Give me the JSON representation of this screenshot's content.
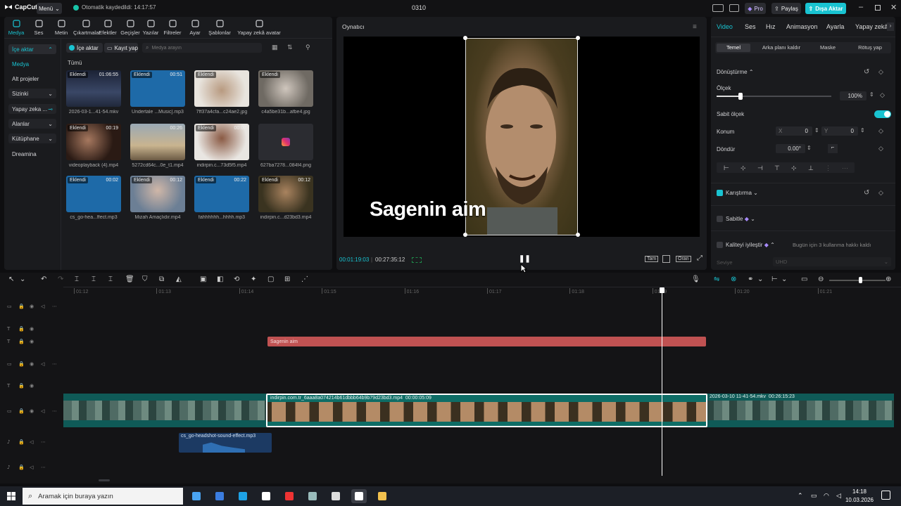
{
  "topbar": {
    "logo": "CapCut",
    "menu": "Menü",
    "autosave": "Otomatik kaydedildi: 14:17:57",
    "project_title": "0310",
    "pro": "Pro",
    "share": "Paylaş",
    "export": "Dışa Aktar",
    "accent": "#19c3d1"
  },
  "toolbar": [
    {
      "label": "Medya",
      "icon": "media-icon"
    },
    {
      "label": "Ses",
      "icon": "audio-icon"
    },
    {
      "label": "Metin",
      "icon": "text-icon"
    },
    {
      "label": "Çıkartmalar",
      "icon": "sticker-icon"
    },
    {
      "label": "Efektler",
      "icon": "effects-icon"
    },
    {
      "label": "Geçişler",
      "icon": "transition-icon"
    },
    {
      "label": "Yazılar",
      "icon": "captions-icon"
    },
    {
      "label": "Filtreler",
      "icon": "filter-icon"
    },
    {
      "label": "Ayar",
      "icon": "adjust-icon"
    },
    {
      "label": "Şablonlar",
      "icon": "template-icon"
    },
    {
      "label": "Yapay zekâ avatar",
      "icon": "ai-avatar-icon"
    }
  ],
  "sidenav": [
    {
      "label": "İçe aktar"
    },
    {
      "label": "Medya"
    },
    {
      "label": "Alt projeler"
    },
    {
      "label": "Sizinki"
    },
    {
      "label": "Yapay zeka ..."
    },
    {
      "label": "Alanlar"
    },
    {
      "label": "Kütüphane"
    },
    {
      "label": "Dreamina"
    }
  ],
  "media": {
    "import": "İçe aktar",
    "record": "Kayıt yap",
    "search_placeholder": "Medya arayın",
    "filter": "Tümü",
    "items": [
      {
        "tag": "Eklendi",
        "duration": "01:06:55",
        "name": "2026-03-1...41-54.mkv"
      },
      {
        "tag": "Eklendi",
        "duration": "00:51",
        "name": "Undertale ...Music].mp3"
      },
      {
        "tag": "Eklendi",
        "duration": "",
        "name": "7ff37a4cfa...c24ae2.jpg"
      },
      {
        "tag": "Eklendi",
        "duration": "",
        "name": "c4a5be31b...afbe4.jpg"
      },
      {
        "tag": "Eklendi",
        "duration": "00:19",
        "name": "videoplayback (4).mp4"
      },
      {
        "tag": "",
        "duration": "00:26",
        "name": "5272cd64c...0e_t1.mp4"
      },
      {
        "tag": "Eklendi",
        "duration": "00:07",
        "name": "indirpin.c...73d5f5.mp4"
      },
      {
        "tag": "",
        "duration": "",
        "name": "627ba7278...084f4.png"
      },
      {
        "tag": "Eklendi",
        "duration": "00:02",
        "name": "cs_go-hea...ffect.mp3"
      },
      {
        "tag": "Eklendi",
        "duration": "00:12",
        "name": "Mizah Amaçlıdır.mp4"
      },
      {
        "tag": "Eklendi",
        "duration": "00:22",
        "name": "fahhhhhh...hhhh.mp3"
      },
      {
        "tag": "Eklendi",
        "duration": "00:12",
        "name": "indirpin.c...d23bd3.mp4"
      }
    ]
  },
  "player": {
    "title": "Oynatıcı",
    "caption": "Sagenin aim",
    "current_time": "00:01:19:03",
    "total_time": "00:27:35:12",
    "full": "Tam",
    "ratio": "Oran"
  },
  "inspector": {
    "tabs": [
      "Video",
      "Ses",
      "Hız",
      "Animasyon",
      "Ayarla",
      "Yapay zekâ"
    ],
    "subtabs": [
      "Temel",
      "Arka planı kaldır",
      "Maske",
      "Rötuş yap"
    ],
    "transform": "Dönüştürme",
    "scale_label": "Ölçek",
    "scale_value": "100%",
    "uniform_scale": "Sabit ölçek",
    "position_label": "Konum",
    "pos_x_label": "X",
    "pos_x": "0",
    "pos_y_label": "Y",
    "pos_y": "0",
    "rotate_label": "Döndür",
    "rotate_value": "0.00°",
    "blend": "Karıştırma",
    "stabilize": "Sabitle",
    "enhance": "Kaliteyi iyileştir",
    "enhance_note": "Bugün için 3 kullanma hakkı kaldı",
    "level_label": "Seviye",
    "level_value": "UHD"
  },
  "timeline": {
    "ticks": [
      "01:12",
      "01:13",
      "01:14",
      "01:15",
      "01:16",
      "01:17",
      "01:18",
      "01:19",
      "01:20",
      "01:21"
    ],
    "text_clip": "Sagenin aim",
    "main_clip_name": "indirpin.com.tr_6aaa8a074214b61dbbb64b9b79d23bd3.mp4",
    "main_clip_dur": "00:00:05:09",
    "right_clip_name": "2026-03-10 11-41-54.mkv",
    "right_clip_dur": "00:26:15:23",
    "audio_clip": "cs_go-headshot-sound-effect.mp3"
  },
  "taskbar": {
    "search": "Aramak için buraya yazın",
    "time": "14:18",
    "date": "10.03.2026"
  }
}
